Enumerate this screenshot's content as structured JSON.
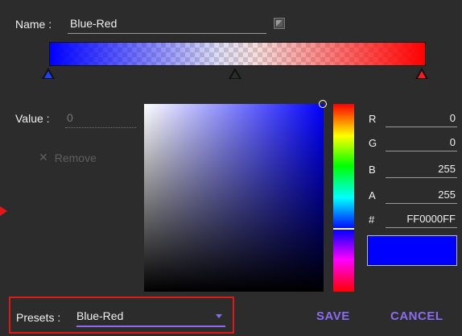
{
  "gradient_editor": {
    "name_label": "Name :",
    "name_value": "Blue-Red",
    "value_label": "Value :",
    "value_input": "0",
    "remove_label": "Remove",
    "gradient_stops": [
      {
        "color": "#0000FF",
        "icon": "blue-stop-marker"
      },
      {
        "color": "#2c2c2c",
        "icon": "selected-midpoint-marker"
      },
      {
        "color": "#FF0000",
        "icon": "red-stop-marker"
      }
    ]
  },
  "color_picker": {
    "channels": [
      {
        "label": "R",
        "value": "0"
      },
      {
        "label": "G",
        "value": "0"
      },
      {
        "label": "B",
        "value": "255"
      },
      {
        "label": "A",
        "value": "255"
      },
      {
        "label": "#",
        "value": "FF0000FF"
      }
    ],
    "current_color": "#0000FF",
    "hue_color": "#0000FF"
  },
  "footer": {
    "presets_label": "Presets :",
    "presets_value": "Blue-Red",
    "save_label": "SAVE",
    "cancel_label": "CANCEL"
  },
  "accent_color": "#8b6bf2",
  "highlight_color": "#e01818"
}
